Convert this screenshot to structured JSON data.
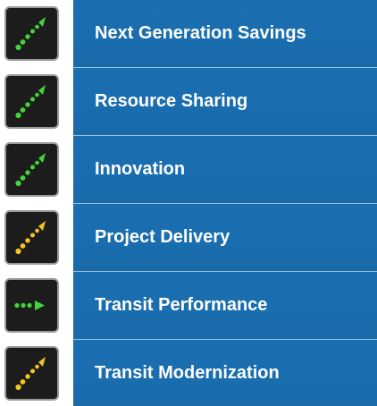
{
  "colors": {
    "panel_blue": "#1b6fb0",
    "divider": "#9cc4e2",
    "icon_bg": "#1c1c1c",
    "icon_border": "#9a9a9a",
    "status_green": "#43d33b",
    "status_yellow": "#f2c61f"
  },
  "items": [
    {
      "label": "Next Generation Savings",
      "trend": "up",
      "status": "green",
      "icon": "trending-up-dots-icon"
    },
    {
      "label": "Resource Sharing",
      "trend": "up",
      "status": "green",
      "icon": "trending-up-dots-icon"
    },
    {
      "label": "Innovation",
      "trend": "up",
      "status": "green",
      "icon": "trending-up-dots-icon"
    },
    {
      "label": "Project Delivery",
      "trend": "up",
      "status": "yellow",
      "icon": "trending-up-dots-icon"
    },
    {
      "label": "Transit Performance",
      "trend": "flat",
      "status": "green",
      "icon": "trending-flat-dots-icon"
    },
    {
      "label": "Transit Modernization",
      "trend": "up",
      "status": "yellow",
      "icon": "trending-up-dots-icon"
    }
  ]
}
